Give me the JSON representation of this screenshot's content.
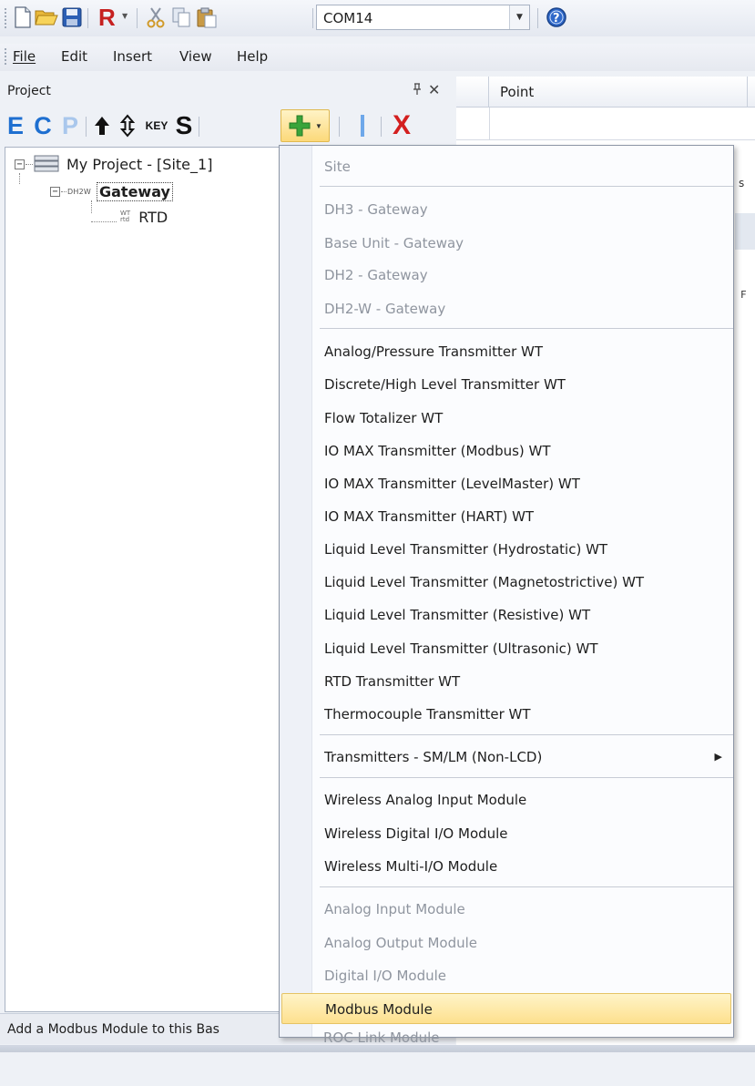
{
  "toolbar": {
    "com_port": "COM14",
    "buttons": [
      "new-file",
      "open-folder",
      "save",
      "read",
      "cut",
      "copy",
      "paste",
      "help"
    ]
  },
  "menubar": {
    "file": "File",
    "edit": "Edit",
    "insert": "Insert",
    "view": "View",
    "help": "Help"
  },
  "project_panel": {
    "title": "Project",
    "pin_glyph": "、",
    "close_glyph": "✕",
    "toolbar": {
      "e": "E",
      "c": "C",
      "p": "P",
      "key": "KEY",
      "s": "S",
      "i": "I",
      "x": "X"
    }
  },
  "tree": {
    "root": "My Project - [Site_1]",
    "gateway_tag": "DH2W",
    "gateway": "Gateway",
    "rtd_tag_top": "WT",
    "rtd_tag_bottom": "rtd",
    "rtd": "RTD"
  },
  "grid": {
    "column_point": "Point",
    "fragment_s": "s",
    "fragment_r": "F"
  },
  "status": {
    "text": "Add a Modbus Module to this Bas"
  },
  "context_menu": {
    "items": [
      {
        "label": "Site",
        "enabled": false
      },
      {
        "label": "DH3 - Gateway",
        "enabled": false
      },
      {
        "label": "Base Unit - Gateway",
        "enabled": false
      },
      {
        "label": "DH2 - Gateway",
        "enabled": false
      },
      {
        "label": "DH2-W - Gateway",
        "enabled": false
      },
      {
        "label": "Analog/Pressure Transmitter WT",
        "enabled": true
      },
      {
        "label": "Discrete/High Level Transmitter WT",
        "enabled": true
      },
      {
        "label": "Flow Totalizer WT",
        "enabled": true
      },
      {
        "label": "IO MAX Transmitter (Modbus) WT",
        "enabled": true
      },
      {
        "label": "IO MAX Transmitter (LevelMaster) WT",
        "enabled": true
      },
      {
        "label": "IO MAX Transmitter (HART) WT",
        "enabled": true
      },
      {
        "label": "Liquid Level Transmitter (Hydrostatic) WT",
        "enabled": true
      },
      {
        "label": "Liquid Level Transmitter (Magnetostrictive) WT",
        "enabled": true
      },
      {
        "label": "Liquid Level Transmitter (Resistive) WT",
        "enabled": true
      },
      {
        "label": "Liquid Level Transmitter (Ultrasonic) WT",
        "enabled": true
      },
      {
        "label": "RTD Transmitter WT",
        "enabled": true
      },
      {
        "label": "Thermocouple Transmitter WT",
        "enabled": true
      },
      {
        "label": "Transmitters - SM/LM (Non-LCD)",
        "enabled": true,
        "submenu": true
      },
      {
        "label": "Wireless Analog Input Module",
        "enabled": true
      },
      {
        "label": "Wireless Digital I/O Module",
        "enabled": true
      },
      {
        "label": "Wireless Multi-I/O Module",
        "enabled": true
      },
      {
        "label": "Analog Input Module",
        "enabled": false
      },
      {
        "label": "Analog Output Module",
        "enabled": false
      },
      {
        "label": "Digital I/O Module",
        "enabled": false
      },
      {
        "label": "Modbus Module",
        "enabled": true,
        "highlighted": true
      },
      {
        "label": "ROC Link Module",
        "enabled": false
      }
    ]
  },
  "colors": {
    "highlight": "#fde08e",
    "accent_blue": "#1e6fd0",
    "accent_red": "#d31f1f",
    "accent_green": "#3aa43a"
  }
}
